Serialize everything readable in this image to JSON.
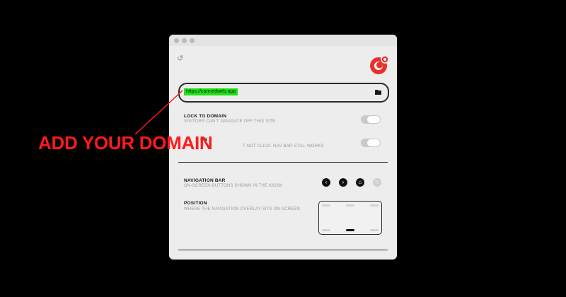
{
  "url_field": {
    "value": "https://cannedweb.app"
  },
  "settings": {
    "lock_title": "LOCK TO DOMAIN",
    "lock_desc": "VISITORS CAN'T NAVIGATE OFF THIS SITE",
    "lock_enabled": true,
    "second_title_fragment": "ON",
    "second_desc_fragment": "T NOT CLICK. NAV BAR STILL WORKS",
    "second_enabled": true
  },
  "navigation": {
    "title": "NAVIGATION BAR",
    "desc": "ON-SCREEN BUTTONS SHOWN IN THE KIOSK",
    "buttons": [
      {
        "icon": "back-icon",
        "glyph": "‹",
        "enabled": true
      },
      {
        "icon": "forward-icon",
        "glyph": "›",
        "enabled": true
      },
      {
        "icon": "home-icon",
        "glyph": "⌂",
        "enabled": true
      },
      {
        "icon": "reload-icon",
        "glyph": "↻",
        "enabled": false
      }
    ]
  },
  "position": {
    "title": "POSITION",
    "desc": "WHERE THE NAVIGATION OVERLAY SITS ON SCREEN",
    "selected": "bottom-center"
  },
  "annotation": {
    "text": "ADD YOUR DOMAIN",
    "color": "#ff1a1a"
  },
  "colors": {
    "url_highlight": "#22e01a",
    "logo_red": "#e8312b"
  }
}
